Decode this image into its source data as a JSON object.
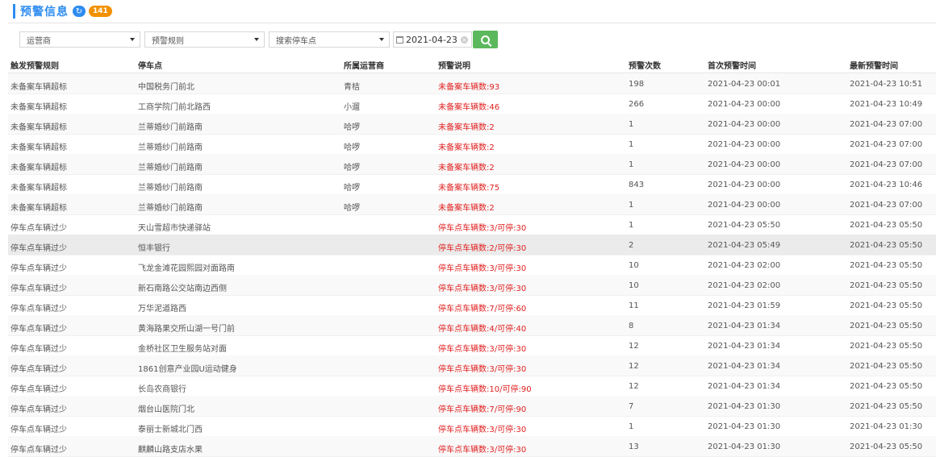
{
  "header": {
    "title": "预警信息",
    "badge": "141"
  },
  "filters": {
    "operator": "运营商",
    "rule": "预警规则",
    "stop": "搜索停车点",
    "date": "2021-04-23"
  },
  "columns": [
    "触发预警规则",
    "停车点",
    "所属运营商",
    "预警说明",
    "预警次数",
    "首次预警时间",
    "最新预警时间"
  ],
  "rows": [
    [
      "未备案车辆超标",
      "中国税务门前北",
      "青桔",
      "未备案车辆数:93",
      "198",
      "2021-04-23 00:01",
      "2021-04-23 10:51"
    ],
    [
      "未备案车辆超标",
      "工商学院门前北路西",
      "小遛",
      "未备案车辆数:46",
      "266",
      "2021-04-23 00:00",
      "2021-04-23 10:49"
    ],
    [
      "未备案车辆超标",
      "兰蒂婚纱门前路南",
      "哈啰",
      "未备案车辆数:2",
      "1",
      "2021-04-23 00:00",
      "2021-04-23 07:00"
    ],
    [
      "未备案车辆超标",
      "兰蒂婚纱门前路南",
      "哈啰",
      "未备案车辆数:2",
      "1",
      "2021-04-23 00:00",
      "2021-04-23 07:00"
    ],
    [
      "未备案车辆超标",
      "兰蒂婚纱门前路南",
      "哈啰",
      "未备案车辆数:2",
      "1",
      "2021-04-23 00:00",
      "2021-04-23 07:00"
    ],
    [
      "未备案车辆超标",
      "兰蒂婚纱门前路南",
      "哈啰",
      "未备案车辆数:75",
      "843",
      "2021-04-23 00:00",
      "2021-04-23 10:46"
    ],
    [
      "未备案车辆超标",
      "兰蒂婚纱门前路南",
      "哈啰",
      "未备案车辆数:2",
      "1",
      "2021-04-23 00:00",
      "2021-04-23 07:00"
    ],
    [
      "停车点车辆过少",
      "天山雪超市快递驿站",
      "",
      "停车点车辆数:3/可停:30",
      "1",
      "2021-04-23 05:50",
      "2021-04-23 05:50"
    ],
    [
      "停车点车辆过少",
      "恒丰银行",
      "",
      "停车点车辆数:2/可停:30",
      "2",
      "2021-04-23 05:49",
      "2021-04-23 05:50"
    ],
    [
      "停车点车辆过少",
      "飞龙金滩花园熙园对面路南",
      "",
      "停车点车辆数:3/可停:30",
      "10",
      "2021-04-23 02:00",
      "2021-04-23 05:50"
    ],
    [
      "停车点车辆过少",
      "新石南路公交站南边西侧",
      "",
      "停车点车辆数:3/可停:30",
      "10",
      "2021-04-23 02:00",
      "2021-04-23 05:50"
    ],
    [
      "停车点车辆过少",
      "万华泥道路西",
      "",
      "停车点车辆数:7/可停:60",
      "11",
      "2021-04-23 01:59",
      "2021-04-23 05:50"
    ],
    [
      "停车点车辆过少",
      "黄海路果交所山湖一号门前",
      "",
      "停车点车辆数:4/可停:40",
      "8",
      "2021-04-23 01:34",
      "2021-04-23 05:50"
    ],
    [
      "停车点车辆过少",
      "金桥社区卫生服务站对面",
      "",
      "停车点车辆数:3/可停:30",
      "12",
      "2021-04-23 01:34",
      "2021-04-23 05:50"
    ],
    [
      "停车点车辆过少",
      "1861创意产业园U运动健身",
      "",
      "停车点车辆数:3/可停:30",
      "12",
      "2021-04-23 01:34",
      "2021-04-23 05:50"
    ],
    [
      "停车点车辆过少",
      "长岛农商银行",
      "",
      "停车点车辆数:10/可停:90",
      "12",
      "2021-04-23 01:34",
      "2021-04-23 05:50"
    ],
    [
      "停车点车辆过少",
      "烟台山医院门北",
      "",
      "停车点车辆数:7/可停:90",
      "7",
      "2021-04-23 01:30",
      "2021-04-23 05:50"
    ],
    [
      "停车点车辆过少",
      "泰丽士新城北门西",
      "",
      "停车点车辆数:3/可停:30",
      "1",
      "2021-04-23 01:30",
      "2021-04-23 01:30"
    ],
    [
      "停车点车辆过少",
      "麒麟山路支店水果",
      "",
      "停车点车辆数:3/可停:30",
      "13",
      "2021-04-23 01:30",
      "2021-04-23 05:50"
    ]
  ]
}
